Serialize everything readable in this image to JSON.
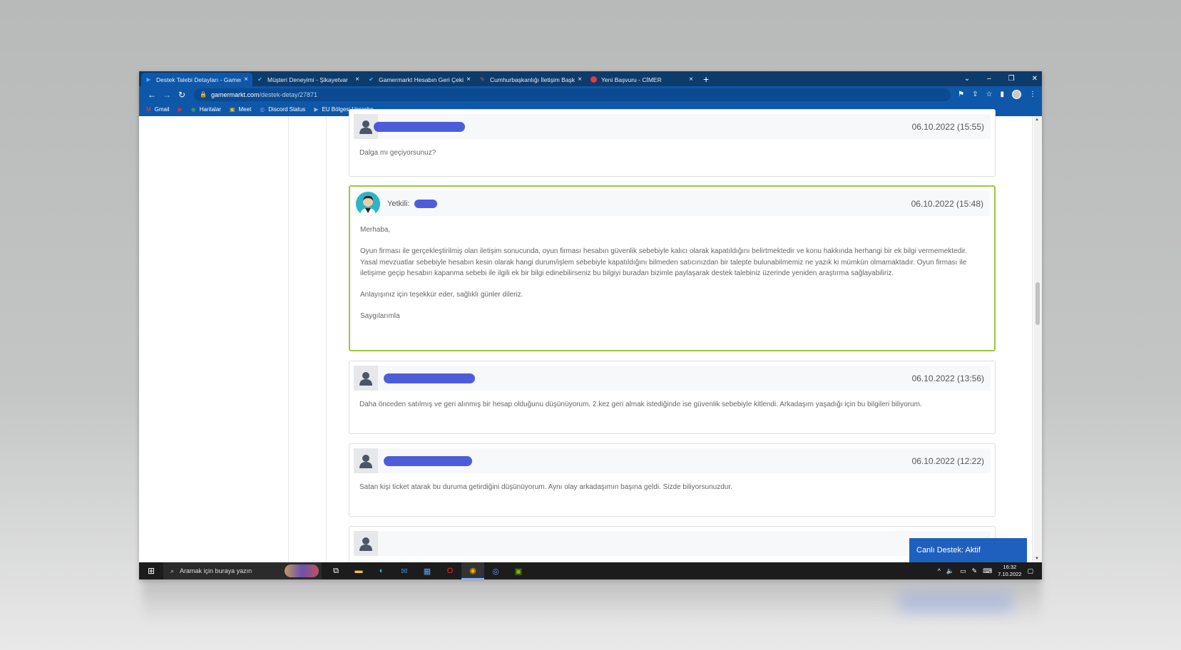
{
  "tabs": [
    {
      "title": "Destek Talebi Detayları - Gamerm",
      "icon": "play-icon",
      "active": true
    },
    {
      "title": "Müşteri Deneyimi - Şikayetvar",
      "icon": "check-icon"
    },
    {
      "title": "Gamermarkt Hesabın Geri Çekilm",
      "icon": "check-icon"
    },
    {
      "title": "Cumhurbaşkanlığı İletişim Başkan",
      "icon": "pen-icon"
    },
    {
      "title": "Yeni Başvuru - CİMER",
      "icon": "cimer-icon"
    }
  ],
  "address": {
    "host": "gamermarkt.com",
    "path": "/destek-detay/27871"
  },
  "bookmarks": [
    {
      "label": "Gmail",
      "icon": "gmail-icon"
    },
    {
      "label": "",
      "icon": "youtube-icon"
    },
    {
      "label": "Haritalar",
      "icon": "maps-icon"
    },
    {
      "label": "Meet",
      "icon": "meet-icon"
    },
    {
      "label": "Discord Status",
      "icon": "discord-icon"
    },
    {
      "label": "EU Bölgesi Unranke...",
      "icon": "play-icon"
    }
  ],
  "messages": [
    {
      "date": "06.10.2022 (15:55)",
      "body": [
        "Dalga mı geçiyorsunuz?"
      ]
    },
    {
      "date": "06.10.2022 (15:48)",
      "staff_label": "Yetkili:",
      "body": [
        "Merhaba,",
        "Oyun firması ile gerçekleştirilmiş olan iletişim sonucunda, oyun firması hesabın güvenlik sebebiyle kalıcı olarak kapatıldığını belirtmektedir ve konu hakkında herhangi bir ek bilgi vermemektedir. Yasal mevzuatlar sebebiyle hesabın kesin olarak hangi durum/işlem sebebiyle kapatıldığını bilmeden satıcınızdan bir talepte bulunabilmemiz ne yazık ki mümkün olmamaktadır. Oyun firması ile iletişime geçip hesabın kapanma sebebi ile ilgili ek bir bilgi edinebilirseniz bu bilgiyi buradan bizimle paylaşarak destek talebiniz üzerinde yeniden araştırma sağlayabiliriz.",
        "Anlayışınız için teşekkür eder, sağlıklı günler dileriz.",
        "Saygılarımla"
      ]
    },
    {
      "date": "06.10.2022 (13:56)",
      "body": [
        "Daha önceden satılmış ve geri alınmış bir hesap olduğunu düşünüyorum. 2.kez geri almak istediğinde ise güvenlik sebebiyle kitlendi. Arkadaşım yaşadığı için bu bilgileri biliyorum."
      ]
    },
    {
      "date": "06.10.2022 (12:22)",
      "body": [
        "Satan kişi ticket atarak bu duruma getirdiğini düşünüyorum. Aynı olay arkadaşımın başına geldi. Sizde biliyorsunuzdur."
      ]
    }
  ],
  "live_support": "Canlı Destek: Aktif",
  "taskbar": {
    "search_placeholder": "Aramak için buraya yazın",
    "time": "16:32",
    "date": "7.10.2022"
  }
}
